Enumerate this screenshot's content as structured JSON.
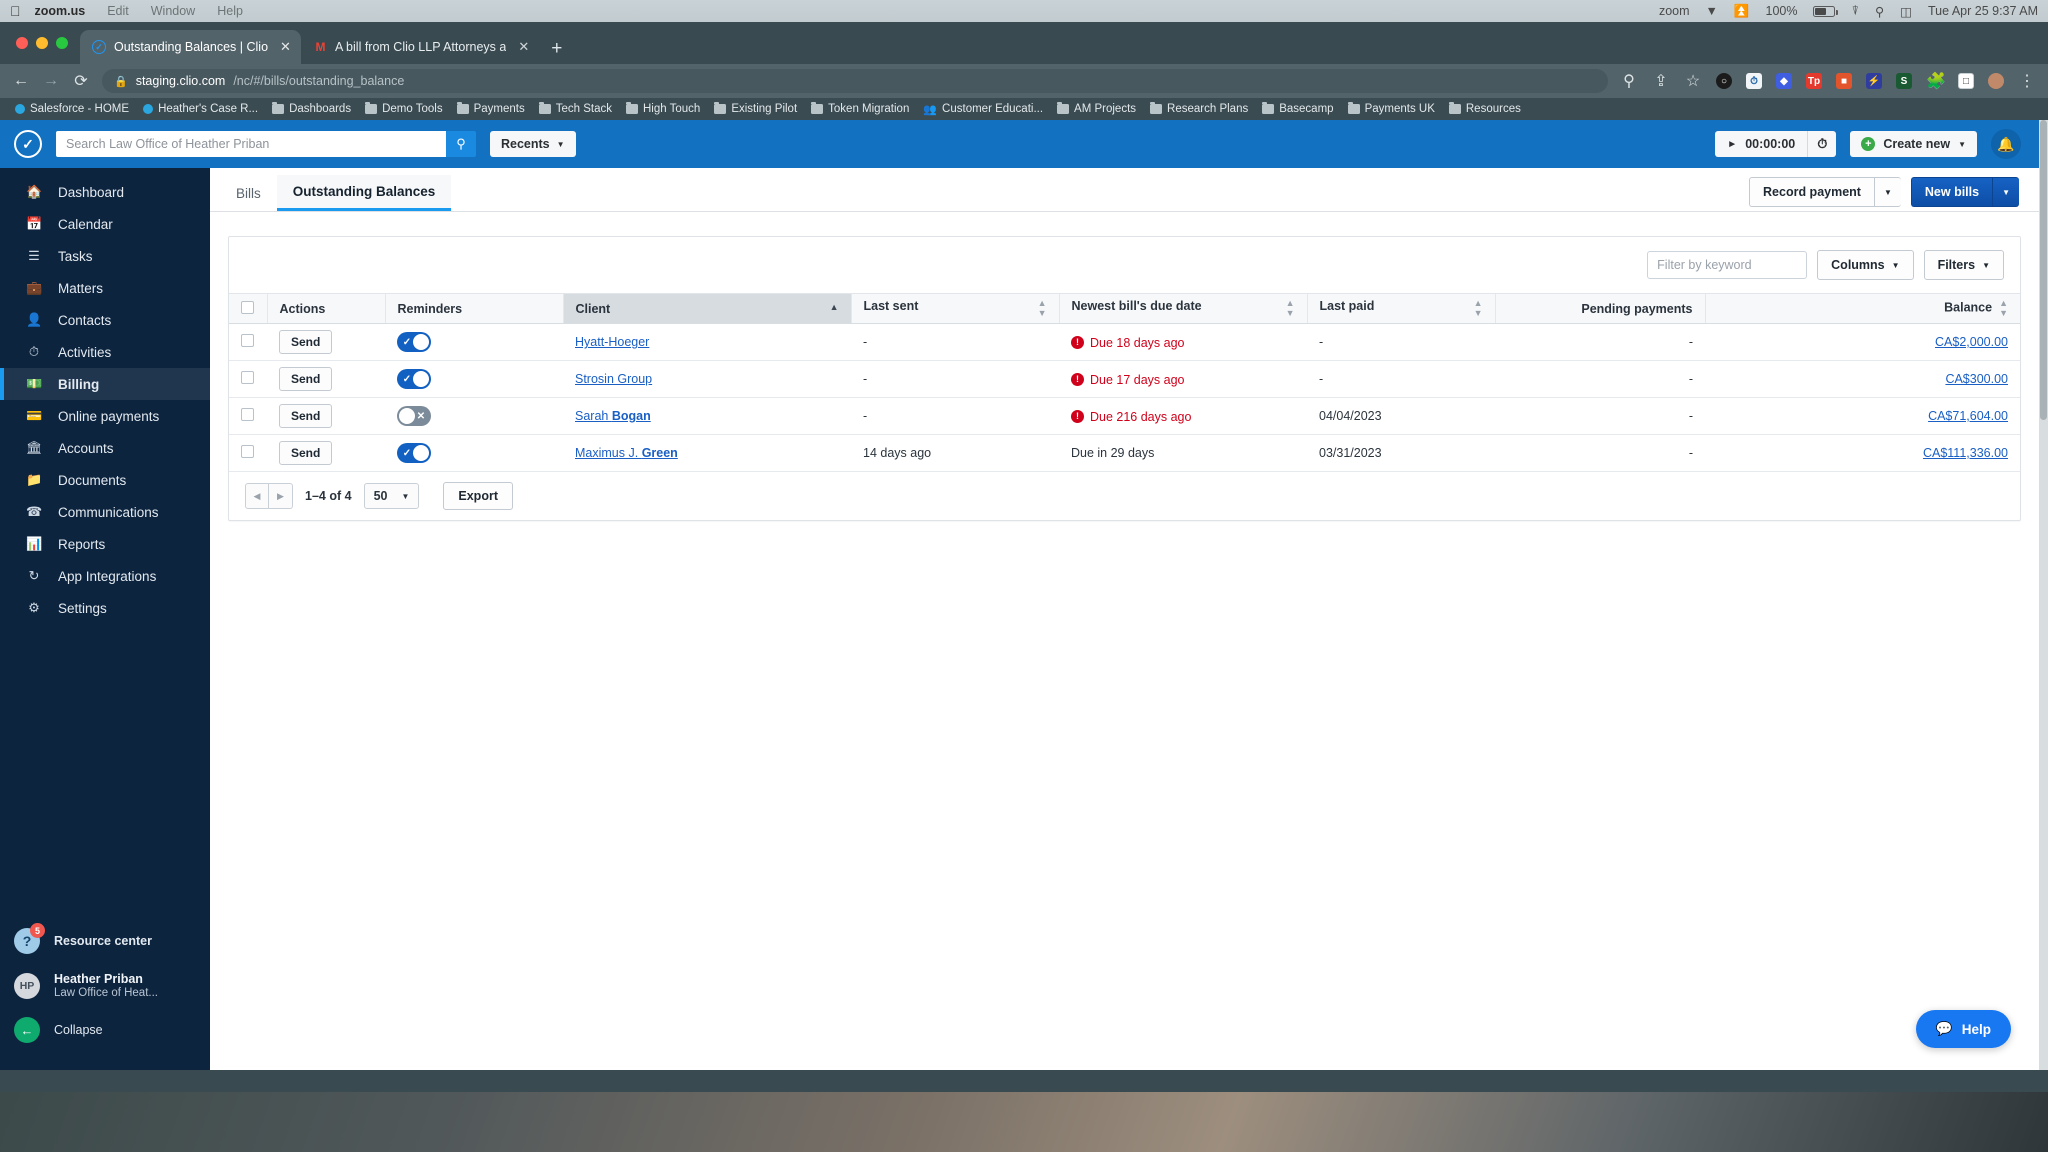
{
  "macos": {
    "app_name": "zoom.us",
    "menus": [
      "Edit",
      "Window",
      "Help"
    ],
    "status_right": [
      "zoom"
    ],
    "battery": "100%",
    "datetime": "Tue Apr 25  9:37 AM"
  },
  "browser": {
    "tabs": [
      {
        "title": "Outstanding Balances | Clio",
        "favicon": "clio-icon",
        "active": true
      },
      {
        "title": "A bill from Clio LLP Attorneys a",
        "favicon": "gmail-icon",
        "active": false
      }
    ],
    "new_tab_label": "+",
    "url_host": "staging.clio.com",
    "url_path": "/nc/#/bills/outstanding_balance",
    "bookmarks": [
      {
        "label": "Salesforce - HOME",
        "icon": "blue-dot-icon"
      },
      {
        "label": "Heather's Case R...",
        "icon": "blue-dot-icon"
      },
      {
        "label": "Dashboards",
        "icon": "folder-icon"
      },
      {
        "label": "Demo Tools",
        "icon": "folder-icon"
      },
      {
        "label": "Payments",
        "icon": "folder-icon"
      },
      {
        "label": "Tech Stack",
        "icon": "folder-icon"
      },
      {
        "label": "High Touch",
        "icon": "folder-icon"
      },
      {
        "label": "Existing Pilot",
        "icon": "folder-icon"
      },
      {
        "label": "Token Migration",
        "icon": "folder-icon"
      },
      {
        "label": "Customer Educati...",
        "icon": "people-icon"
      },
      {
        "label": "AM Projects",
        "icon": "folder-icon"
      },
      {
        "label": "Research Plans",
        "icon": "folder-icon"
      },
      {
        "label": "Basecamp",
        "icon": "folder-icon"
      },
      {
        "label": "Payments UK",
        "icon": "folder-icon"
      },
      {
        "label": "Resources",
        "icon": "folder-icon"
      }
    ]
  },
  "app": {
    "search_placeholder": "Search Law Office of Heather Priban",
    "recents_label": "Recents",
    "timer_value": "00:00:00",
    "create_new_label": "Create new",
    "brand_color": "#1271c0"
  },
  "sidebar": {
    "items": [
      {
        "label": "Dashboard",
        "icon": "home-icon",
        "active": false
      },
      {
        "label": "Calendar",
        "icon": "calendar-icon",
        "active": false
      },
      {
        "label": "Tasks",
        "icon": "list-icon",
        "active": false
      },
      {
        "label": "Matters",
        "icon": "briefcase-icon",
        "active": false
      },
      {
        "label": "Contacts",
        "icon": "person-icon",
        "active": false
      },
      {
        "label": "Activities",
        "icon": "clock-icon",
        "active": false
      },
      {
        "label": "Billing",
        "icon": "billing-icon",
        "active": true
      },
      {
        "label": "Online payments",
        "icon": "card-icon",
        "active": false
      },
      {
        "label": "Accounts",
        "icon": "bank-icon",
        "active": false
      },
      {
        "label": "Documents",
        "icon": "folder-icon",
        "active": false
      },
      {
        "label": "Communications",
        "icon": "phone-icon",
        "active": false
      },
      {
        "label": "Reports",
        "icon": "chart-icon",
        "active": false
      },
      {
        "label": "App Integrations",
        "icon": "sync-icon",
        "active": false
      },
      {
        "label": "Settings",
        "icon": "gear-icon",
        "active": false
      }
    ],
    "resource_center": {
      "label": "Resource center",
      "badge": "5"
    },
    "user": {
      "name": "Heather Priban",
      "firm": "Law Office of Heat...",
      "initials": "HP"
    },
    "collapse_label": "Collapse"
  },
  "page": {
    "tabs": [
      {
        "label": "Bills",
        "active": false
      },
      {
        "label": "Outstanding Balances",
        "active": true
      }
    ],
    "record_payment_label": "Record payment",
    "new_bills_label": "New bills",
    "filter_placeholder": "Filter by keyword",
    "columns_label": "Columns",
    "filters_label": "Filters"
  },
  "table": {
    "headers": [
      {
        "label": "",
        "type": "checkbox"
      },
      {
        "label": "Actions",
        "sort": "none"
      },
      {
        "label": "Reminders",
        "sort": "none"
      },
      {
        "label": "Client",
        "sort": "asc"
      },
      {
        "label": "Last sent",
        "sort": "both"
      },
      {
        "label": "Newest bill's due date",
        "sort": "both"
      },
      {
        "label": "Last paid",
        "sort": "both"
      },
      {
        "label": "Pending payments",
        "sort": "none",
        "align": "right"
      },
      {
        "label": "Balance",
        "sort": "both",
        "align": "right"
      }
    ],
    "action_label": "Send",
    "rows": [
      {
        "client": "Hyatt-Hoeger",
        "client_bold": "",
        "reminder_on": true,
        "last_sent": "-",
        "due_date": "Due 18 days ago",
        "overdue": true,
        "last_paid": "-",
        "pending": "-",
        "balance": "CA$2,000.00"
      },
      {
        "client": "Strosin Group",
        "client_bold": "",
        "reminder_on": true,
        "last_sent": "-",
        "due_date": "Due 17 days ago",
        "overdue": true,
        "last_paid": "-",
        "pending": "-",
        "balance": "CA$300.00"
      },
      {
        "client": "Sarah ",
        "client_bold": "Bogan",
        "reminder_on": false,
        "last_sent": "-",
        "due_date": "Due 216 days ago",
        "overdue": true,
        "last_paid": "04/04/2023",
        "pending": "-",
        "balance": "CA$71,604.00"
      },
      {
        "client": "Maximus J. ",
        "client_bold": "Green",
        "reminder_on": true,
        "last_sent": "14 days ago",
        "due_date": "Due in 29 days",
        "overdue": false,
        "last_paid": "03/31/2023",
        "pending": "-",
        "balance": "CA$111,336.00"
      }
    ]
  },
  "pagination": {
    "range": "1–4 of 4",
    "page_size": "50",
    "export_label": "Export"
  },
  "help_widget": {
    "label": "Help"
  }
}
